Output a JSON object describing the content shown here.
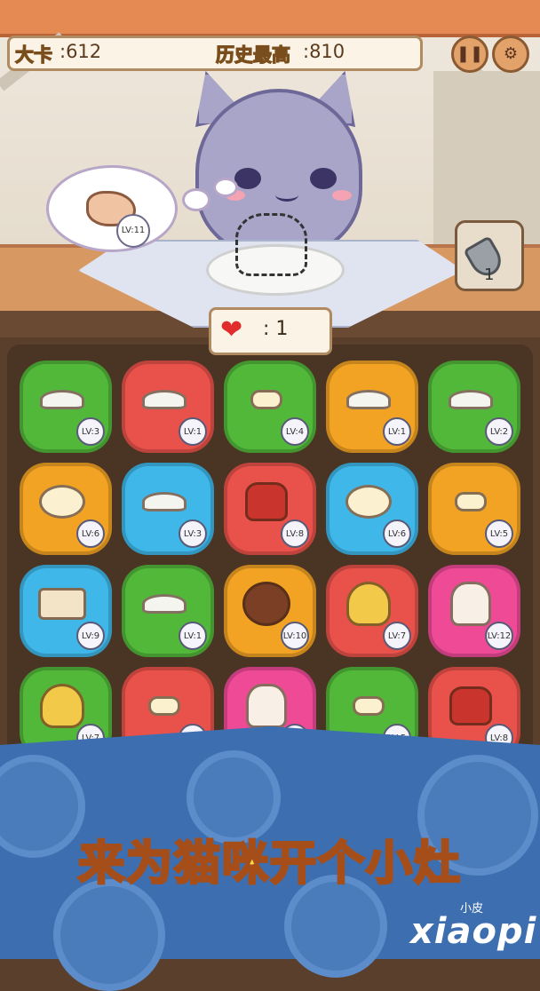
{
  "header": {
    "score_label": "大卡",
    "score_value": ":612",
    "best_label": "历史最高",
    "best_value": ":810",
    "pause_icon": "pause-icon",
    "settings_icon": "gear-icon"
  },
  "order": {
    "item": "swiss-roll-cake",
    "level": "LV:11"
  },
  "shovel": {
    "icon": "shovel-icon",
    "count": "1"
  },
  "hearts": {
    "icon": "heart-icon",
    "count": ": 1"
  },
  "colors": {
    "green": "#52b83a",
    "red": "#e8524a",
    "orange": "#f2a323",
    "blue": "#3fb7e8",
    "pink": "#ee4a96"
  },
  "board": {
    "rows": [
      [
        {
          "color": "green",
          "item": "flour",
          "level": "LV:3"
        },
        {
          "color": "red",
          "item": "flour",
          "level": "LV:1"
        },
        {
          "color": "green",
          "item": "butter",
          "level": "LV:4"
        },
        {
          "color": "orange",
          "item": "flour",
          "level": "LV:1"
        },
        {
          "color": "green",
          "item": "flour",
          "level": "LV:2"
        }
      ],
      [
        {
          "color": "orange",
          "item": "dough",
          "level": "LV:6"
        },
        {
          "color": "blue",
          "item": "flour",
          "level": "LV:3"
        },
        {
          "color": "red",
          "item": "pudding",
          "level": "LV:8"
        },
        {
          "color": "blue",
          "item": "dough",
          "level": "LV:6"
        },
        {
          "color": "orange",
          "item": "butter",
          "level": "LV:5"
        }
      ],
      [
        {
          "color": "blue",
          "item": "cake-slice",
          "level": "LV:9"
        },
        {
          "color": "green",
          "item": "flour",
          "level": "LV:1"
        },
        {
          "color": "orange",
          "item": "donut",
          "level": "LV:10"
        },
        {
          "color": "red",
          "item": "muffin",
          "level": "LV:7"
        },
        {
          "color": "pink",
          "item": "lava-cake",
          "level": "LV:12"
        }
      ],
      [
        {
          "color": "green",
          "item": "muffin",
          "level": "LV:7"
        },
        {
          "color": "red",
          "item": "butter",
          "level": "LV:4"
        },
        {
          "color": "pink",
          "item": "lava-cake",
          "level": "LV:12"
        },
        {
          "color": "green",
          "item": "butter",
          "level": "LV:5"
        },
        {
          "color": "red",
          "item": "pudding",
          "level": "LV:8"
        }
      ]
    ]
  },
  "slogan": "来为猫咪开个小灶",
  "watermark": {
    "small": "小皮",
    "large": "xiaopi"
  }
}
